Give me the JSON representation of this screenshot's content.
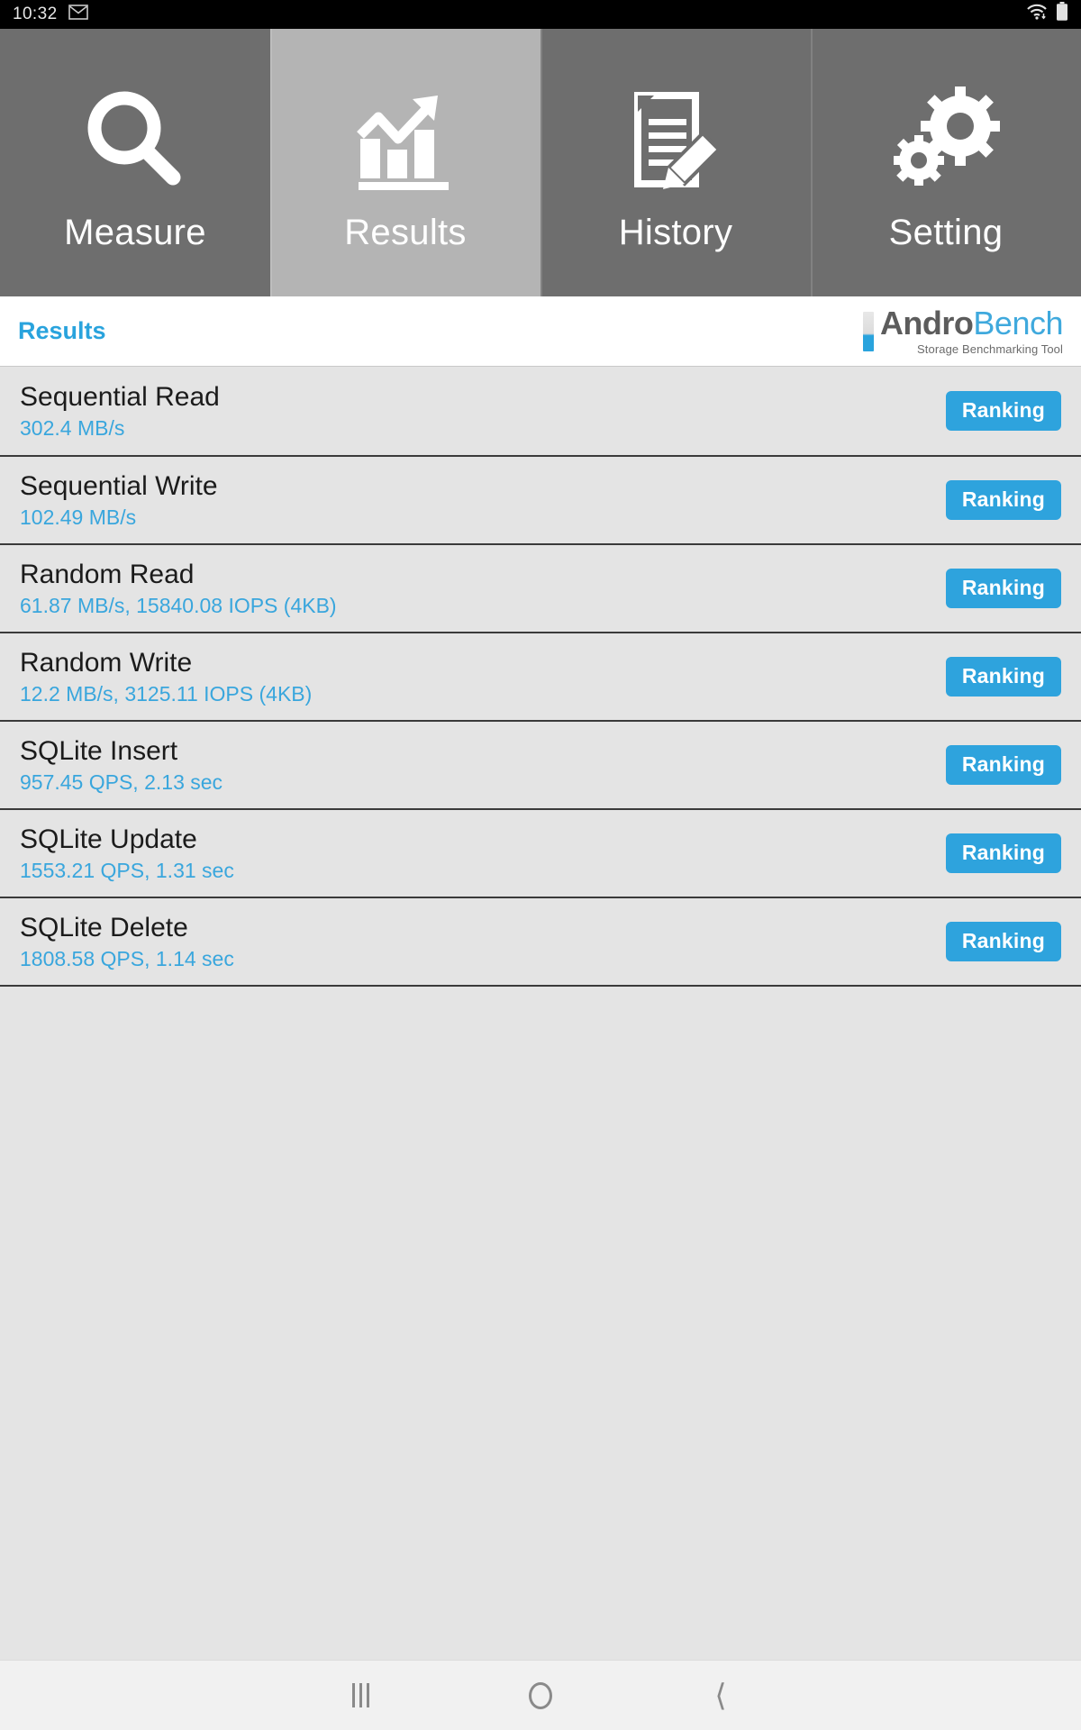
{
  "statusbar": {
    "clock": "10:32",
    "notification_icon": "gmail-icon",
    "wifi_icon": "wifi-icon",
    "battery_icon": "battery-icon"
  },
  "tabs": [
    {
      "label": "Measure",
      "icon": "magnifier-icon",
      "active": false
    },
    {
      "label": "Results",
      "icon": "bar-chart-trend-icon",
      "active": true
    },
    {
      "label": "History",
      "icon": "document-pencil-icon",
      "active": false
    },
    {
      "label": "Setting",
      "icon": "gears-icon",
      "active": false
    }
  ],
  "header": {
    "title": "Results",
    "logo": {
      "name_part1": "Andro",
      "name_part2": "Bench",
      "tagline": "Storage Benchmarking Tool"
    }
  },
  "results": [
    {
      "title": "Sequential Read",
      "value": "302.4 MB/s",
      "action": "Ranking"
    },
    {
      "title": "Sequential Write",
      "value": "102.49 MB/s",
      "action": "Ranking"
    },
    {
      "title": "Random Read",
      "value": "61.87 MB/s, 15840.08 IOPS (4KB)",
      "action": "Ranking"
    },
    {
      "title": "Random Write",
      "value": "12.2 MB/s, 3125.11 IOPS (4KB)",
      "action": "Ranking"
    },
    {
      "title": "SQLite Insert",
      "value": "957.45 QPS, 2.13 sec",
      "action": "Ranking"
    },
    {
      "title": "SQLite Update",
      "value": "1553.21 QPS, 1.31 sec",
      "action": "Ranking"
    },
    {
      "title": "SQLite Delete",
      "value": "1808.58 QPS, 1.14 sec",
      "action": "Ranking"
    }
  ],
  "navbar": {
    "recents_icon": "recents-icon",
    "home_icon": "home-icon",
    "back_icon": "back-icon"
  },
  "colors": {
    "accent_blue": "#2ea3dd",
    "title_blue": "#29a3dd",
    "value_blue": "#39a6dd",
    "tab_inactive": "#6e6e6e",
    "tab_active": "#b4b4b4",
    "list_bg": "#e4e4e4"
  }
}
